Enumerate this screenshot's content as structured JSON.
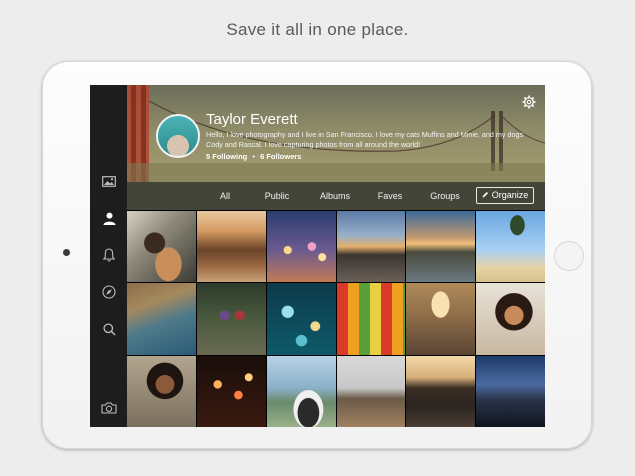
{
  "headline": "Save it all in one place.",
  "profile": {
    "name": "Taylor Everett",
    "bio": "Hello, I love photography and I live in San Francisco. I love my cats Muffins and Minie, and my dogs Cody and Rascal. I love capturing photos from all around the world!",
    "following": "5 Following",
    "separator": "•",
    "followers": "6 Followers"
  },
  "tabs": [
    "All",
    "Public",
    "Albums",
    "Faves",
    "Groups"
  ],
  "organize_label": "Organize",
  "sidebar": [
    "photos-icon",
    "profile-icon",
    "notifications-icon",
    "explore-icon",
    "search-icon",
    "camera-icon"
  ],
  "photos": [
    "woman-in-car",
    "pool-deck",
    "city-bokeh",
    "railroad-sunset",
    "lake-sunset",
    "palm-beach",
    "rocky-coast",
    "hikers-forest",
    "bokeh-lights",
    "fruit-market",
    "old-street",
    "curly-hair-portrait",
    "woman-laughing",
    "sparklers",
    "dog-by-lake",
    "dog-on-pier",
    "rowboat-lake",
    "evening-bay"
  ]
}
